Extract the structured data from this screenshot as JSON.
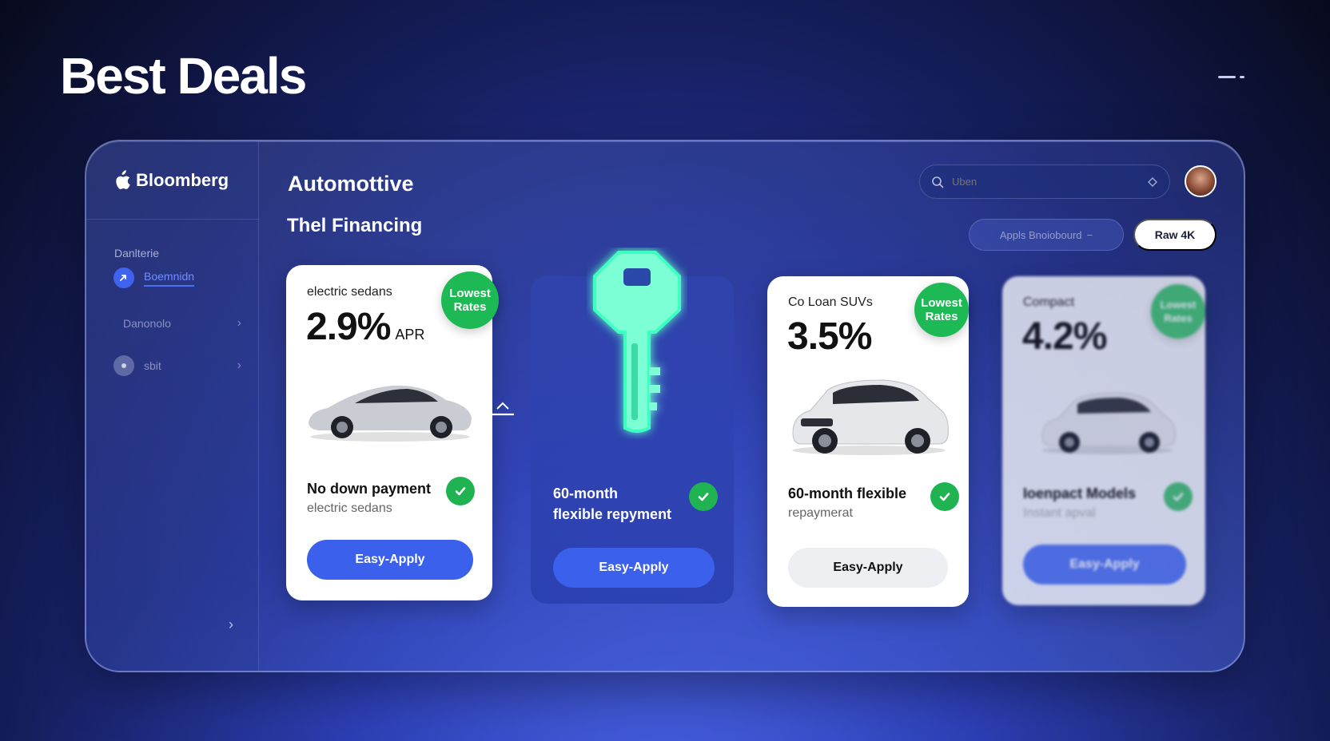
{
  "page": {
    "headline": "Best Deals"
  },
  "sidebar": {
    "brand": "Bloomberg",
    "section_label": "Danlterie",
    "items": [
      {
        "label": "Boemnidn",
        "active": true,
        "icon": "loan-icon"
      },
      {
        "label": "Danonolo",
        "active": false,
        "icon": "",
        "chevron": true
      },
      {
        "label": "sbit",
        "active": false,
        "icon": "circle-icon",
        "chevron": true
      }
    ]
  },
  "header": {
    "title": "Automottive",
    "subtitle": "Thel Financing",
    "search_placeholder": "Uben",
    "filter_label": "Appls  Bnoiobourd",
    "filter_caret": "−",
    "action_button": "Raw 4K"
  },
  "cards": [
    {
      "kicker": "electric sedans",
      "rate": "2.9%",
      "rate_unit": "APR",
      "badge": [
        "Lowest",
        "Rates"
      ],
      "feature_title": "No down payment",
      "feature_sub": "electric sedans",
      "button": "Easy-Apply"
    },
    {
      "feature_title": "60-month",
      "feature_title_2": "flexible repyment",
      "button": "Easy-Apply"
    },
    {
      "kicker": "Co Loan SUVs",
      "rate": "3.5%",
      "badge": [
        "Lowest",
        "Rates"
      ],
      "feature_title": "60-month flexible",
      "feature_sub": "repaymerat",
      "button": "Easy-Apply"
    },
    {
      "kicker": "Compact",
      "rate": "4.2%",
      "badge": [
        "Lowest",
        "Rates"
      ],
      "feature_title": "Ioenpact Models",
      "feature_sub": "Instant apval",
      "button": "Easy-Apply"
    }
  ],
  "colors": {
    "accent": "#3a60ec",
    "badge": "#1db954",
    "key_glow": "#3dffc0"
  }
}
